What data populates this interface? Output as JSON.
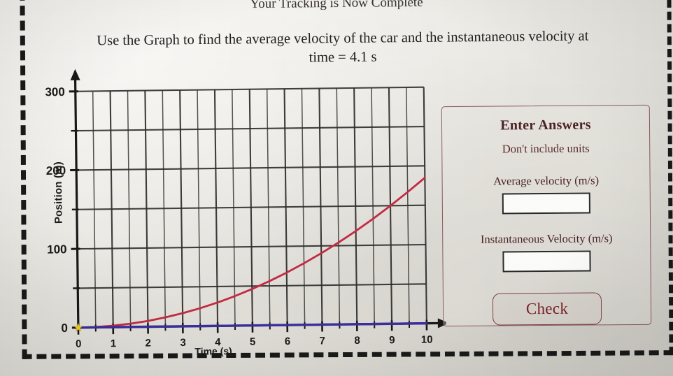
{
  "header": {
    "banner_title": "Your Tracking is Now Complete",
    "prompt_line1": "Use the Graph to find the average velocity of the car and the instantaneous velocity at",
    "prompt_line2": "time = 4.1 s"
  },
  "panel": {
    "title": "Enter Answers",
    "subtitle": "Don't include units",
    "average_label": "Average velocity (m/s)",
    "average_value": "",
    "average_placeholder": "",
    "instantaneous_label": "Instantaneous Velocity (m/s)",
    "instantaneous_value": "",
    "instantaneous_placeholder": "",
    "check_label": "Check",
    "border_color": "#8d5b5e",
    "text_color": "#4a2326",
    "button_text_color": "#7b2228"
  },
  "chart_data": {
    "type": "line",
    "title": "",
    "xlabel": "Time (s)",
    "ylabel": "Position (m)",
    "xlim": [
      0,
      10
    ],
    "ylim": [
      0,
      300
    ],
    "xticks": [
      0,
      1,
      2,
      3,
      4,
      5,
      6,
      7,
      8,
      9,
      10
    ],
    "xtick_labels": [
      "0",
      "1",
      "2",
      "3",
      "4",
      "5",
      "6",
      "7",
      "8",
      "9",
      "10"
    ],
    "yticks": [
      0,
      100,
      200,
      300
    ],
    "ytick_labels": [
      "0",
      "100",
      "200",
      "300"
    ],
    "grid": true,
    "grid_x_step": 0.5,
    "grid_y_step": 50,
    "series": [
      {
        "name": "position-curve",
        "color": "#c22b43",
        "x": [
          0,
          0.5,
          1,
          1.5,
          2,
          2.5,
          3,
          3.5,
          4,
          4.1,
          4.5,
          5,
          5.5,
          6,
          6.5,
          7,
          7.5,
          8,
          8.5,
          9,
          9.5,
          10
        ],
        "y": [
          0,
          0.5,
          1.9,
          4.2,
          7.4,
          11.6,
          16.7,
          22.7,
          29.6,
          31.1,
          37.5,
          46.3,
          56.0,
          66.6,
          78.2,
          90.7,
          104.1,
          118.4,
          133.7,
          149.9,
          167.0,
          185.0
        ]
      },
      {
        "name": "time-axis-line",
        "color": "#3a2f9e",
        "x": [
          0,
          10
        ],
        "y": [
          0,
          0
        ]
      }
    ],
    "markers": [
      {
        "name": "origin-star",
        "x": 0,
        "y": 0,
        "color": "#f2d024",
        "shape": "star"
      }
    ]
  }
}
